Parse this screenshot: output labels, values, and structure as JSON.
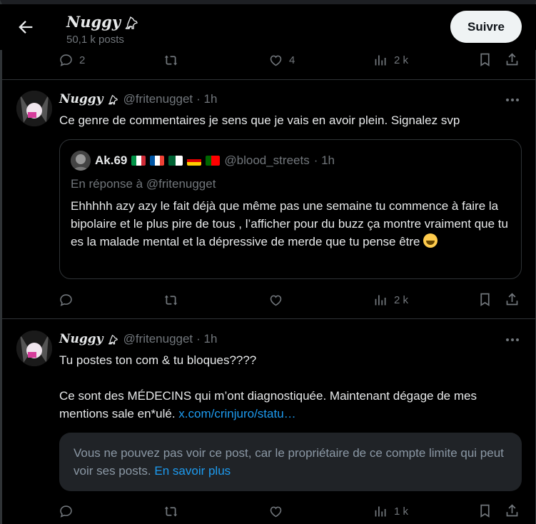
{
  "header": {
    "title": "Nuggy",
    "posts_count": "50,1 k posts",
    "follow_label": "Suivre"
  },
  "top_actions": {
    "replies": "2",
    "reposts": "",
    "likes": "4",
    "views": "2 k"
  },
  "post1": {
    "name": "Nuggy",
    "handle": "@fritenugget",
    "time": "· 1h",
    "text": "Ce genre de commentaires je sens que je vais en avoir plein. Signalez svp",
    "quote": {
      "name": "Ak.69",
      "handle": "@blood_streets",
      "time": "· 1h",
      "reply_to": "En réponse à @fritenugget",
      "text": "Ehhhhh azy azy le fait déjà que même pas une semaine tu commence à faire la bipolaire et le plus pire de tous , l’afficher pour du buzz ça montre vraiment que tu es la malade mental et la dépressive de merde que tu pense être"
    },
    "actions": {
      "replies": "",
      "reposts": "",
      "likes": "",
      "views": "2 k"
    }
  },
  "post2": {
    "name": "Nuggy",
    "handle": "@fritenugget",
    "time": "· 1h",
    "line1": "Tu postes ton com & tu bloques????",
    "line2": "Ce sont des MÉDECINS qui m’ont diagnostiquée. Maintenant dégage de mes mentions sale en*ulé.",
    "link": "x.com/crinjuro/statu…",
    "restricted_text": "Vous ne pouvez pas voir ce post, car le propriétaire de ce compte limite qui peut voir ses posts.",
    "restricted_link": "En savoir plus",
    "actions": {
      "replies": "",
      "reposts": "",
      "likes": "",
      "views": "1 k"
    }
  },
  "colors": {
    "background": "#000000",
    "text": "#e7e9ea",
    "muted": "#71767b",
    "link": "#1d9bf0",
    "border": "#2f3336"
  },
  "icons": [
    "back-arrow-icon",
    "dog-emoji-icon",
    "reply-icon",
    "repost-icon",
    "like-icon",
    "views-icon",
    "bookmark-icon",
    "share-icon",
    "more-icon",
    "laughing-emoji-icon"
  ]
}
